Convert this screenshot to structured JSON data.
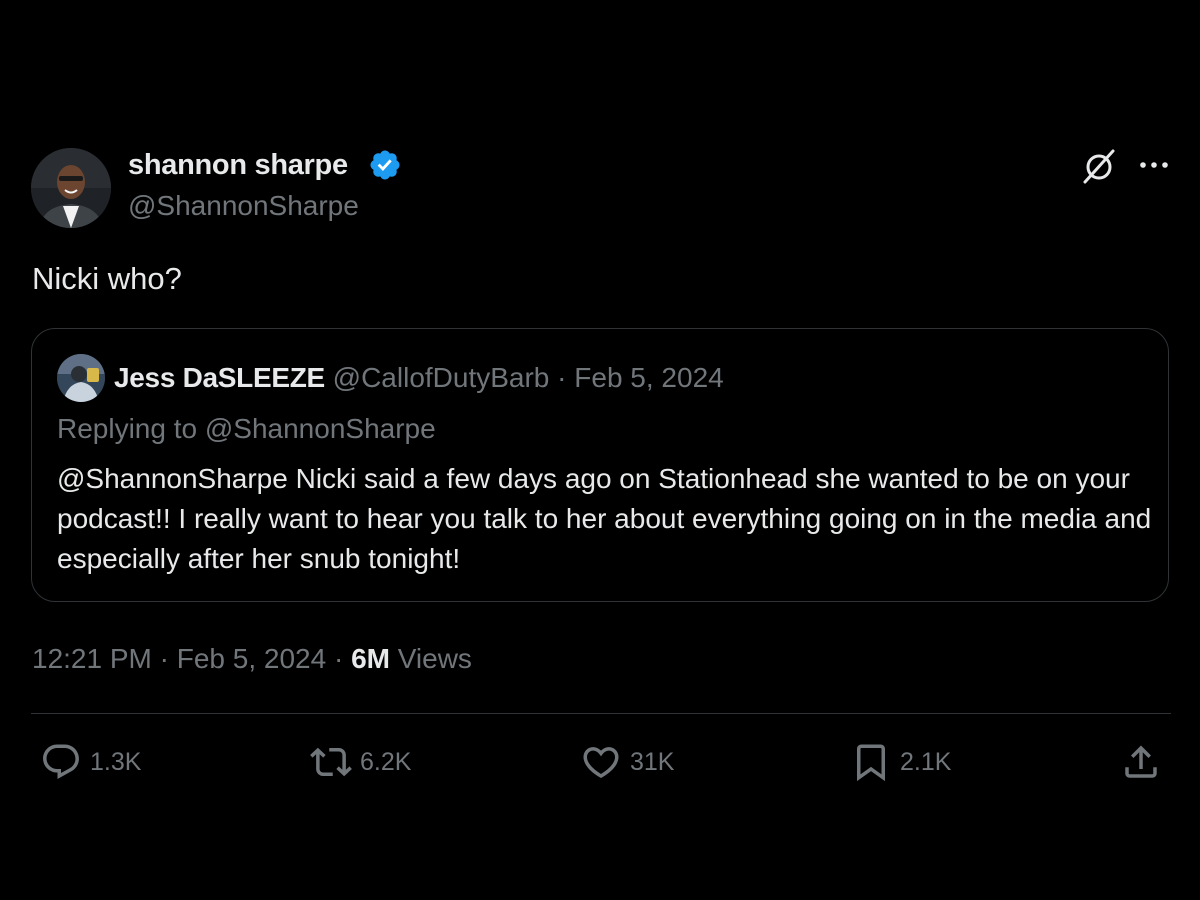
{
  "author": {
    "display_name": "shannon sharpe",
    "handle": "@ShannonSharpe",
    "verified_color": "#1d9bf0"
  },
  "tweet": {
    "text": "Nicki who?"
  },
  "quote": {
    "display_name": "Jess DaSLEEZE",
    "meta": "@CallofDutyBarb · Feb 5, 2024",
    "replying_to": "Replying to @ShannonSharpe",
    "body": "@ShannonSharpe Nicki said a few days ago on Stationhead she wanted to be on your podcast!! I really want to hear you talk to her about everything going on in the media and especially after her snub tonight!"
  },
  "timestamp": {
    "time_date": "12:21 PM · Feb 5, 2024 · ",
    "views_count": "6M",
    "views_label": " Views"
  },
  "actions": {
    "replies": "1.3K",
    "reposts": "6.2K",
    "likes": "31K",
    "bookmarks": "2.1K"
  },
  "icons": {
    "reply": "reply-icon",
    "repost": "repost-icon",
    "like": "heart-icon",
    "bookmark": "bookmark-icon",
    "share": "share-icon",
    "grok": "grok-icon",
    "more": "more-icon",
    "verified": "verified-badge-icon"
  },
  "colors": {
    "background": "#000000",
    "text_primary": "#e7e9ea",
    "text_secondary": "#71767b",
    "border": "#2f3336"
  }
}
